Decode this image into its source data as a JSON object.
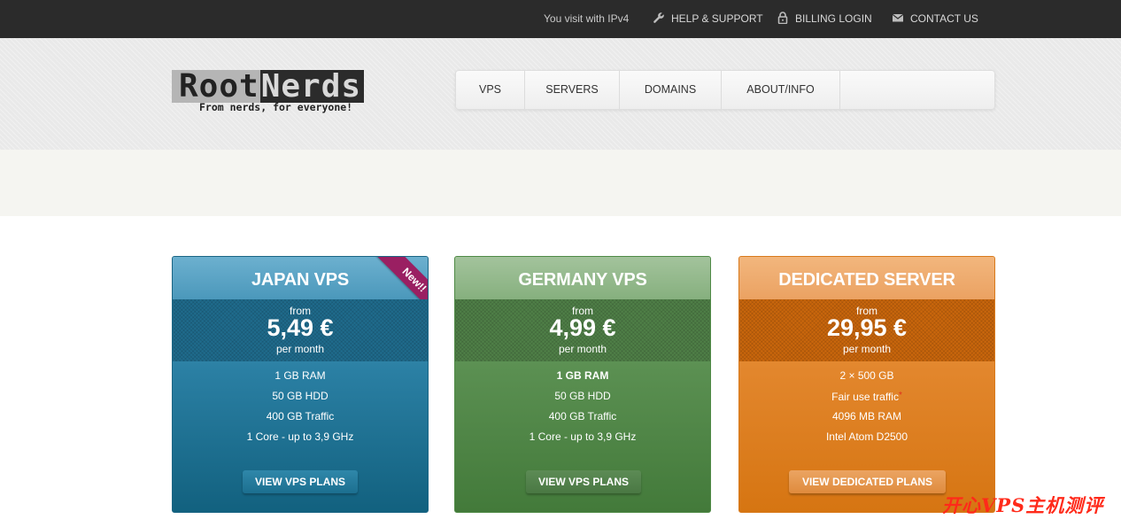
{
  "topbar": {
    "visit_text": "You visit with IPv4",
    "help_support": "HELP & SUPPORT",
    "billing_login": "BILLING LOGIN",
    "contact_us": "CONTACT US"
  },
  "logo": {
    "word_root": "Root",
    "word_nerds": "Nerds",
    "tagline": "From nerds, for everyone!"
  },
  "nav": {
    "items": [
      "VPS",
      "SERVERS",
      "DOMAINS",
      "ABOUT/INFO"
    ]
  },
  "cards": [
    {
      "title": "JAPAN VPS",
      "ribbon": "New!!",
      "from": "from",
      "price": "5,49 €",
      "per": "per month",
      "features": [
        "1 GB RAM",
        "50 GB HDD",
        "400 GB Traffic",
        "1 Core - up to 3,9 GHz"
      ],
      "button": "VIEW VPS PLANS",
      "color": "#2a7fa3"
    },
    {
      "title": "GERMANY VPS",
      "from": "from",
      "price": "4,99 €",
      "per": "per month",
      "features": [
        "1 GB RAM",
        "50 GB HDD",
        "400 GB Traffic",
        "1 Core - up to 3,9 GHz"
      ],
      "button": "VIEW VPS PLANS",
      "color": "#5a8f51"
    },
    {
      "title": "DEDICATED SERVER",
      "from": "from",
      "price": "29,95 €",
      "per": "per month",
      "features": [
        "2 × 500 GB",
        "Fair use traffic",
        "4096 MB RAM",
        "Intel Atom D2500"
      ],
      "feature_marker": "*",
      "button": "VIEW DEDICATED PLANS",
      "color": "#e2862c"
    }
  ],
  "watermark": "开心VPS主机测评",
  "icons": {
    "help": "wrench-icon",
    "billing": "lock-icon",
    "contact": "envelope-icon"
  }
}
